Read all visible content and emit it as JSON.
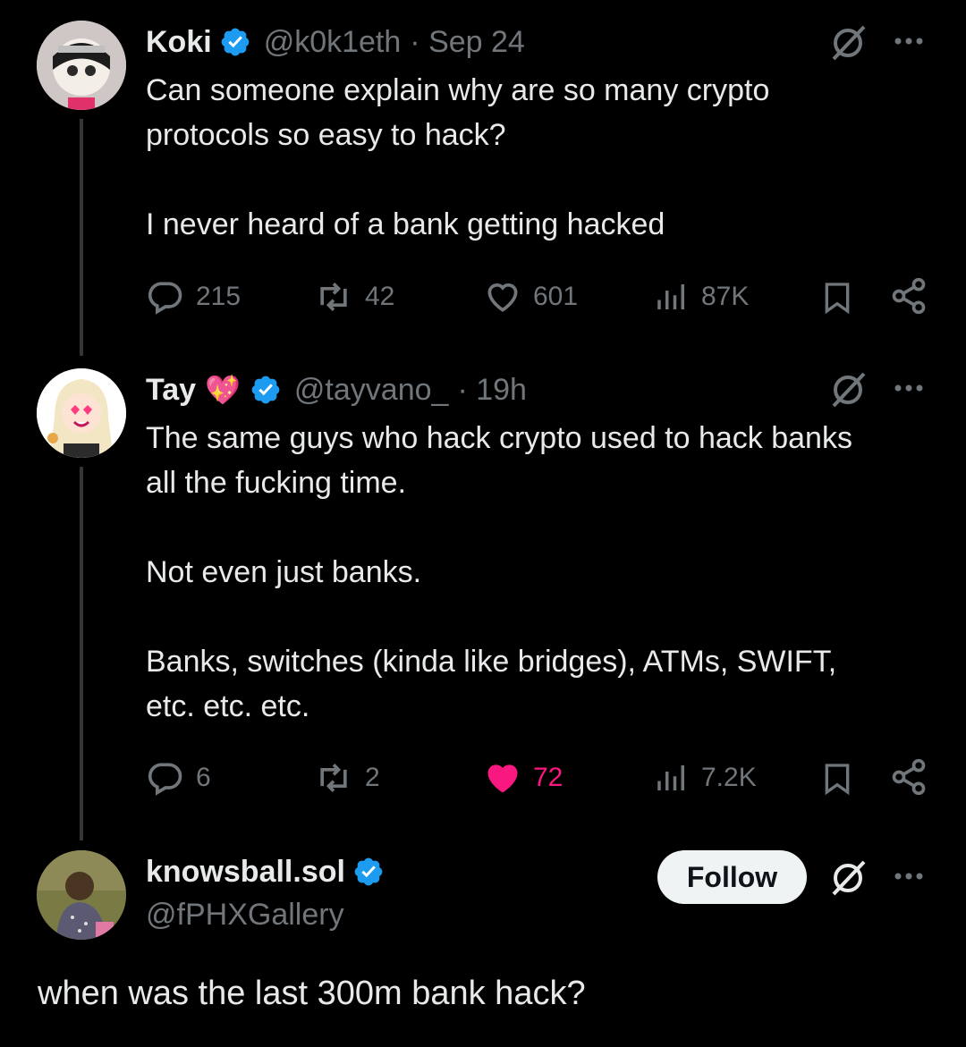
{
  "tweets": [
    {
      "name": "Koki",
      "handle": "@k0k1eth",
      "time": "· Sep 24",
      "lines": [
        "Can someone explain why are so many crypto",
        "protocols so easy to hack?",
        "",
        "I never heard of a bank getting hacked"
      ],
      "replies": "215",
      "reposts": "42",
      "likes": "601",
      "views": "87K"
    },
    {
      "name": "Tay",
      "emoji": "💖",
      "handle": "@tayvano_",
      "time": "· 19h",
      "lines": [
        "The same guys who hack crypto used to hack banks",
        "all the fucking time.",
        "",
        "Not even just banks.",
        "",
        "Banks, switches (kinda like bridges), ATMs, SWIFT,",
        "etc. etc. etc."
      ],
      "replies": "6",
      "reposts": "2",
      "likes": "72",
      "views": "7.2K"
    },
    {
      "name": "knowsball.sol",
      "handle": "@fPHXGallery",
      "follow_label": "Follow",
      "text": "when was the last 300m bank hack?"
    }
  ],
  "colors": {
    "background": "#000000",
    "text": "#e7e9ea",
    "muted": "#71767b",
    "verified": "#1d9bf0",
    "like_active": "#f91880"
  }
}
